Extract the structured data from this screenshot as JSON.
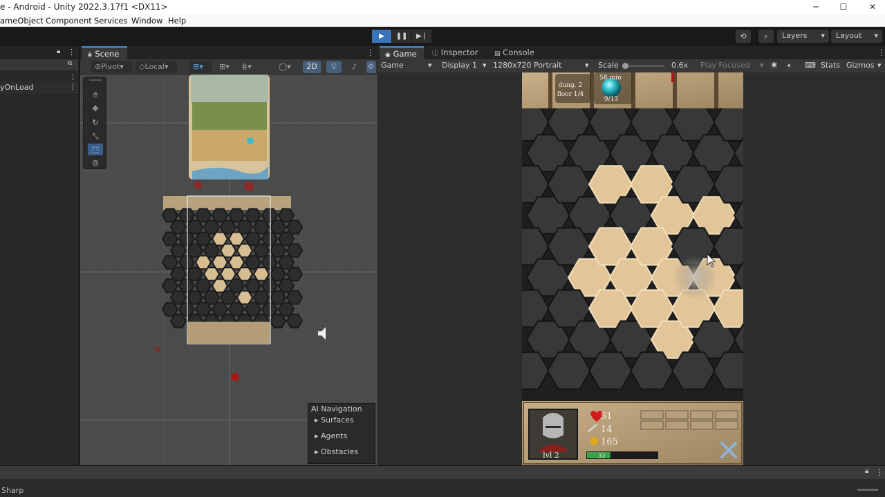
{
  "window": {
    "title": "e - Android - Unity 2022.3.17f1 <DX11>",
    "controls": [
      "─",
      "☐",
      "✕"
    ]
  },
  "menu": [
    "ameObject",
    "Component",
    "Services",
    "Window",
    "Help"
  ],
  "toolbar": {
    "layers_label": "Layers",
    "layout_label": "Layout"
  },
  "hierarchy": {
    "rows": [
      "",
      "",
      "yOnLoad"
    ]
  },
  "scene": {
    "tab_label": "Scene",
    "pivot_label": "Pivot",
    "local_label": "Local",
    "mode_2d_label": "2D"
  },
  "ai_navigation": {
    "title": "AI Navigation",
    "items": [
      "Surfaces",
      "Agents",
      "Obstacles"
    ]
  },
  "game": {
    "tabs": [
      "Game",
      "Inspector",
      "Console"
    ],
    "view_select": "Game",
    "display": "Display 1",
    "resolution": "1280x720 Portrait",
    "scale_label": "Scale",
    "scale_value": "0.6x",
    "play_mode": "Play Focused",
    "stats_label": "Stats",
    "gizmos_label": "Gizmos"
  },
  "hud": {
    "timer": "58 min",
    "dungeon": "dung. 2",
    "floor": "floor 1/4",
    "orb_count": "9/13",
    "health": "51",
    "attack": "14",
    "gold": "165",
    "level": "lvl 2",
    "xp": "33"
  },
  "bottom": {
    "label": "Sharp"
  },
  "colors": {
    "accent": "#3b73b9",
    "tile_light": "#e2c69a",
    "tile_dark": "#383838",
    "health_red": "#d21b1b",
    "gold": "#e0a91c",
    "xp_green": "#3fa04a"
  }
}
